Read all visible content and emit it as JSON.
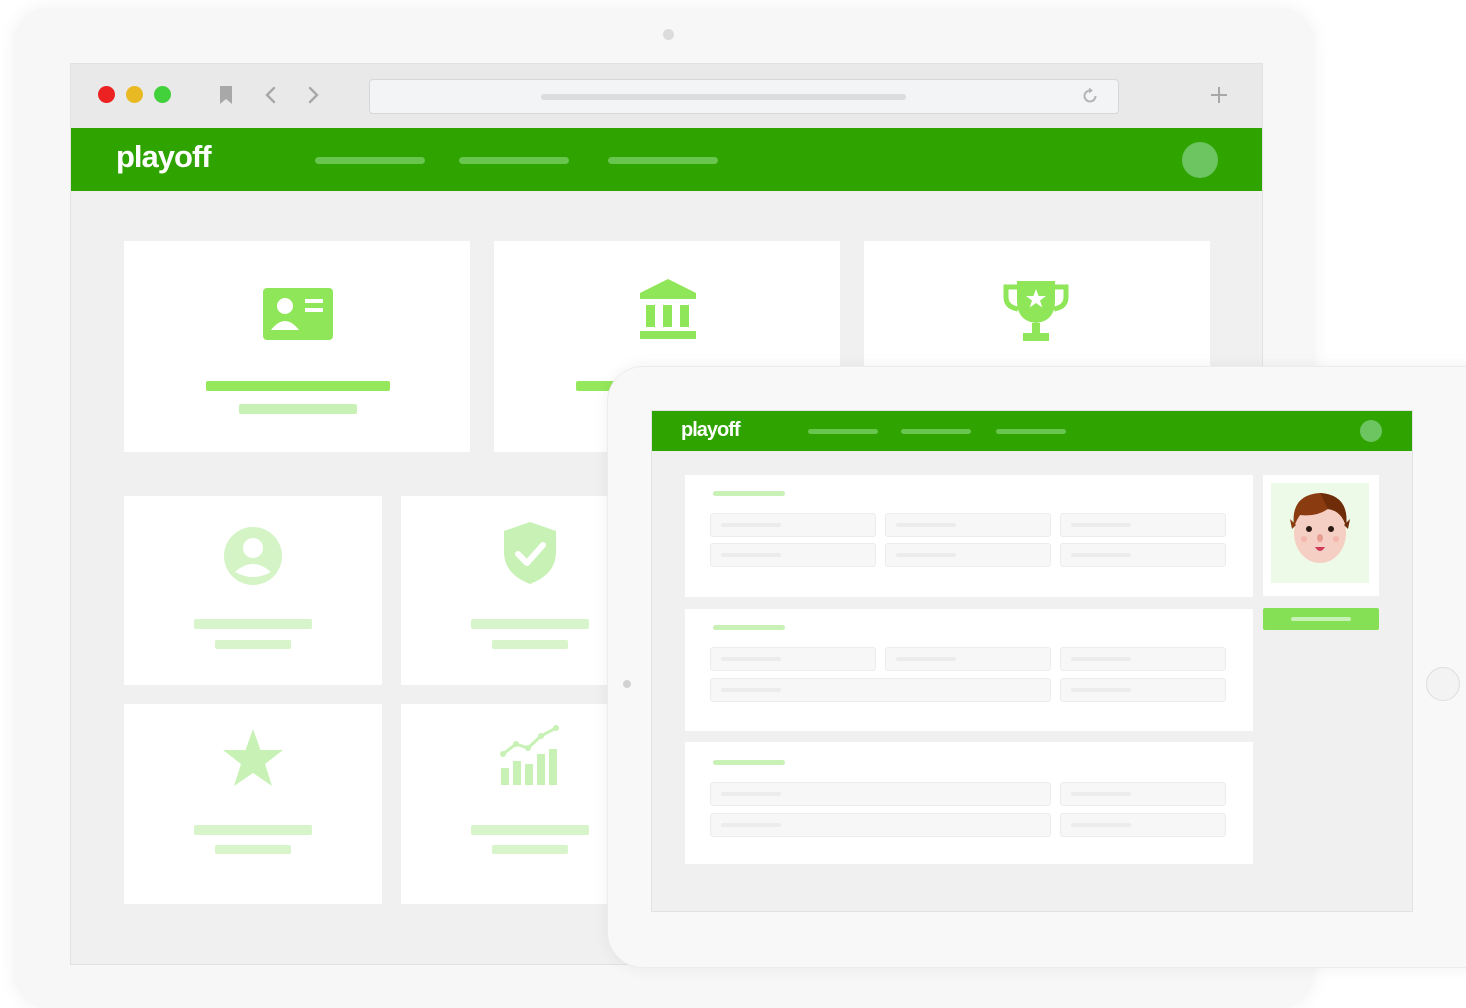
{
  "brand": {
    "logo_text": "playoff",
    "primary_color": "#2fa300",
    "accent_color": "#95e75b",
    "soft_accent_color": "#c8f1b5"
  },
  "browser": {
    "titlebar_buttons": [
      "close",
      "minimize",
      "maximize"
    ],
    "toolbar_icons": [
      "bookmark-icon",
      "back-icon",
      "forward-icon",
      "reload-icon",
      "new-tab-icon"
    ]
  },
  "desktop": {
    "nav_placeholder_links": 3,
    "tiles": [
      {
        "icon": "id-card-icon"
      },
      {
        "icon": "bank-icon"
      },
      {
        "icon": "trophy-icon"
      },
      {
        "icon": "user-icon"
      },
      {
        "icon": "shield-check-icon"
      },
      {
        "icon": "star-icon"
      },
      {
        "icon": "chart-icon"
      }
    ]
  },
  "tablet": {
    "nav_placeholder_links": 3,
    "panels": [
      {
        "rows": [
          3,
          3
        ]
      },
      {
        "rows": [
          3,
          2
        ]
      },
      {
        "rows": [
          2,
          2
        ]
      }
    ],
    "profile": {
      "avatar": "avatar-face-icon"
    }
  }
}
